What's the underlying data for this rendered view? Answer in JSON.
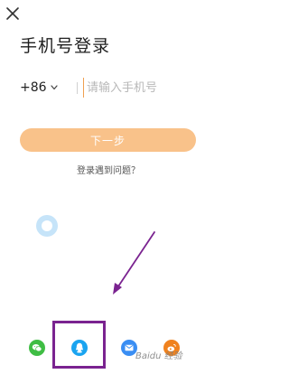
{
  "header": {
    "close_icon": "close-icon",
    "title": "手机号登录"
  },
  "phone": {
    "country_code": "+86",
    "dropdown_icon": "chevron-down-icon",
    "placeholder": "请输入手机号"
  },
  "actions": {
    "next_label": "下一步",
    "help_label": "登录遇到问题？"
  },
  "social_login": {
    "items": [
      {
        "name": "wechat",
        "icon": "wechat-icon",
        "color": "#3fbd44"
      },
      {
        "name": "qq",
        "icon": "qq-penguin-icon",
        "color": "#1aa4f0"
      },
      {
        "name": "email",
        "icon": "mail-icon",
        "color": "#3a8ef3"
      },
      {
        "name": "weibo",
        "icon": "weibo-icon",
        "color": "#f0821e"
      }
    ]
  },
  "annotation": {
    "arrow_color": "#7a2390",
    "highlight_color": "#7a2390"
  },
  "watermark": {
    "text": "Baidu 经验"
  },
  "colors": {
    "accent": "#f9c28a",
    "cursor": "#f0a050",
    "float_ball": "#c6e4f9"
  }
}
